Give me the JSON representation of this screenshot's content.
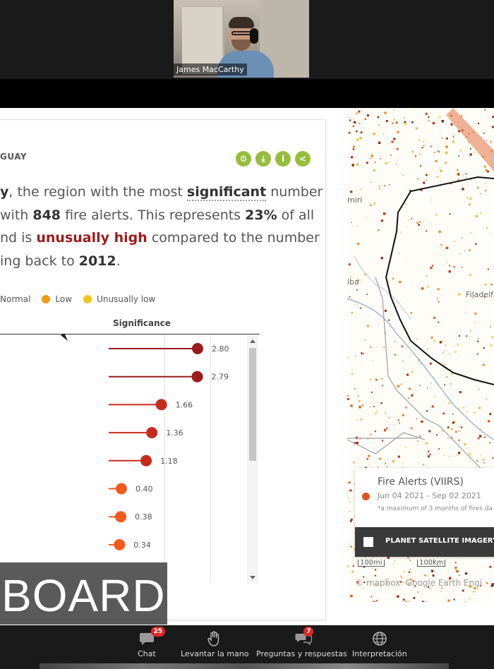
{
  "meeting": {
    "speaker_name": "James MacCarthy"
  },
  "card": {
    "title_partial": "GUAY",
    "summary": {
      "l1_a": "y",
      "l1_b": ", the region with the most ",
      "l1_c": "significant",
      "l1_d": " number",
      "l2_a": "with ",
      "l2_b": "848",
      "l2_c": " fire alerts. This represents ",
      "l2_d": "23%",
      "l2_e": " of all",
      "l3_a": "nd is ",
      "l3_b": "unusually high",
      "l3_c": " compared to the number",
      "l4_a": "ing back to ",
      "l4_b": "2012",
      "l4_c": "."
    },
    "legend": {
      "normal": "Normal",
      "low": "Low",
      "unusually_low": "Unusually low"
    },
    "axis_title": "Significance",
    "overlay_text": "BOARD"
  },
  "colors": {
    "high": "#9b1c1c",
    "medium": "#c72a1c",
    "normal": "#f05a1e",
    "low": "#f29a12",
    "unusually_low": "#f4c51b",
    "accent_green": "#97bd3d"
  },
  "chart_data": {
    "type": "lollipop",
    "axis_title": "Significance",
    "values": [
      2.8,
      2.79,
      1.66,
      1.36,
      1.18,
      0.4,
      0.38,
      0.34
    ],
    "labels": [
      "2.80",
      "2.79",
      "1.66",
      "1.36",
      "1.18",
      "0.40",
      "0.38",
      "0.34"
    ],
    "categories": [
      "",
      "",
      "",
      "",
      "",
      "",
      "",
      ""
    ]
  },
  "map": {
    "labels": {
      "a": "miri",
      "b": "iba",
      "c": "Filadelf"
    },
    "legend_title": "Fire Alerts (VIIRS)",
    "legend_dates": "Jun 04 2021 - Sep 02 2021",
    "legend_note": "*a maximum of 3 months of fires da",
    "planet_label": "PLANET SATELLITE IMAGERY (T",
    "scale_a": "100mi",
    "scale_b": "100km",
    "attribution": "© mapbox  ·Google Earth Engi"
  },
  "toolbar": {
    "chat": "Chat",
    "chat_badge": "25",
    "raise_hand": "Levantar la mano",
    "qa": "Preguntas y respuestas",
    "qa_badge": "7",
    "interpretation": "Interpretación"
  }
}
